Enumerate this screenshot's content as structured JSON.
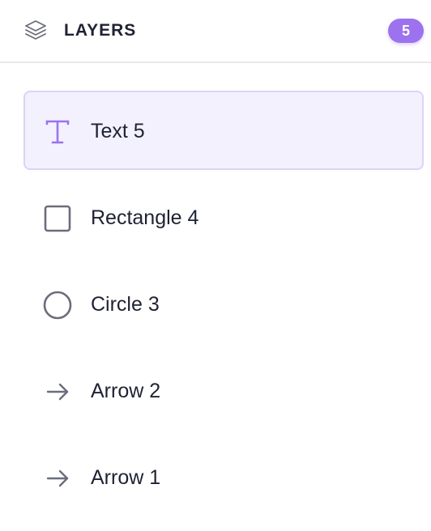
{
  "header": {
    "title": "LAYERS",
    "icon": "layers-icon",
    "count": "5"
  },
  "layers": [
    {
      "label": "Text 5",
      "icon": "text-icon",
      "selected": true
    },
    {
      "label": "Rectangle 4",
      "icon": "rectangle-icon",
      "selected": false
    },
    {
      "label": "Circle 3",
      "icon": "circle-icon",
      "selected": false
    },
    {
      "label": "Arrow 2",
      "icon": "arrow-right-icon",
      "selected": false
    },
    {
      "label": "Arrow 1",
      "icon": "arrow-right-icon",
      "selected": false
    }
  ],
  "colors": {
    "accent": "#9c72ee",
    "selected_bg": "#f3f1fe",
    "selected_border": "#dad4f8",
    "icon_gray": "#6b6d7b",
    "text": "#1f2233"
  }
}
